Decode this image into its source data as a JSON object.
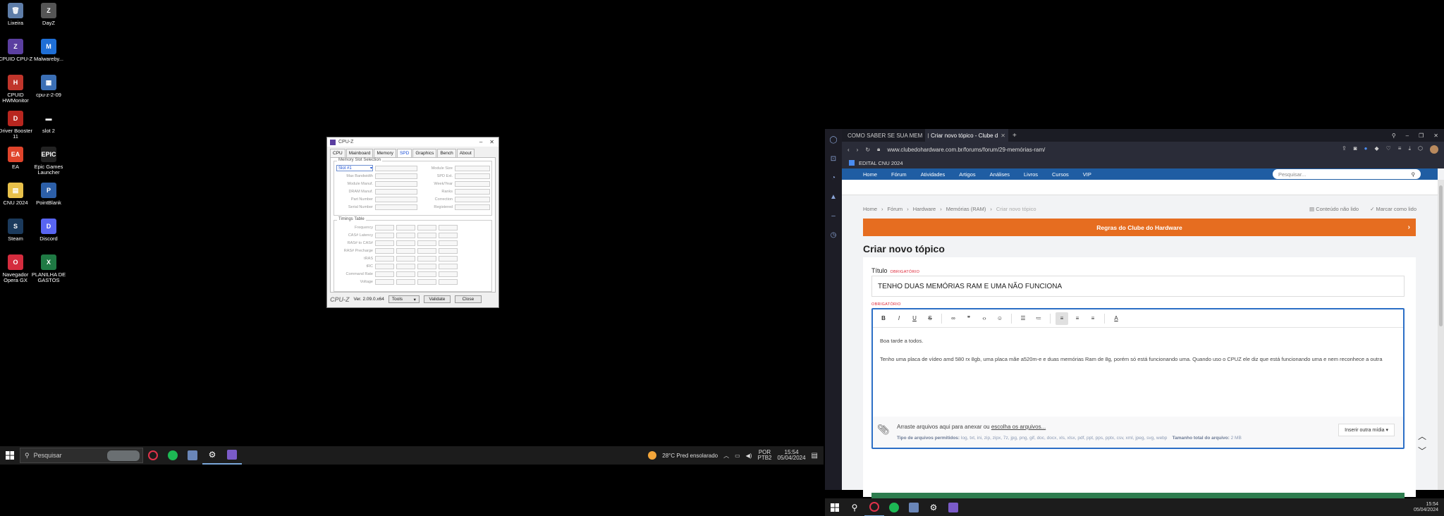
{
  "desktop": {
    "icons": [
      {
        "label": "Lixeira",
        "color": "#5e7da8",
        "glyph": "🗑"
      },
      {
        "label": "DayZ",
        "color": "#555555",
        "glyph": "Z"
      },
      {
        "label": "CPUID CPU-Z",
        "color": "#5b3fa0",
        "glyph": "Z"
      },
      {
        "label": "Malwareby...",
        "color": "#1f6fd6",
        "glyph": "M"
      },
      {
        "label": "CPUID HWMonitor",
        "color": "#c0352b",
        "glyph": "H"
      },
      {
        "label": "cpu-z-2-09",
        "color": "#3b6fb5",
        "glyph": "▦"
      },
      {
        "label": "Driver Booster 11",
        "color": "#b8261f",
        "glyph": "D"
      },
      {
        "label": "slot 2",
        "color": "#000000",
        "glyph": "▬"
      },
      {
        "label": "EA",
        "color": "#e0442b",
        "glyph": "EA"
      },
      {
        "label": "Epic Games Launcher",
        "color": "#222222",
        "glyph": "EPIC"
      },
      {
        "label": "CNU 2024",
        "color": "#e8c14a",
        "glyph": "▤"
      },
      {
        "label": "PointBlank",
        "color": "#2c5fa8",
        "glyph": "P"
      },
      {
        "label": "Steam",
        "color": "#1b3a5c",
        "glyph": "S"
      },
      {
        "label": "Discord",
        "color": "#5865f2",
        "glyph": "D"
      },
      {
        "label": "Navegador Opera GX",
        "color": "#d42c3e",
        "glyph": "O"
      },
      {
        "label": "PLANILHA DE GASTOS",
        "color": "#1f7a44",
        "glyph": "X"
      }
    ]
  },
  "taskbar_left": {
    "search_placeholder": "Pesquisar",
    "weather": "28°C  Pred ensolarado",
    "lang": "POR",
    "lang2": "PTB2",
    "time": "15:54",
    "date": "05/04/2024"
  },
  "cpuz": {
    "title": "CPU-Z",
    "tabs": [
      "CPU",
      "Mainboard",
      "Memory",
      "SPD",
      "Graphics",
      "Bench",
      "About"
    ],
    "selected_tab": "SPD",
    "slot_legend": "Memory Slot Selection",
    "slot_value": "Slot #1",
    "left_fields": [
      "Max Bandwidth",
      "Module Manuf.",
      "DRAM Manuf.",
      "Part Number",
      "Serial Number"
    ],
    "right_fields": [
      "Module Size",
      "SPD Ext.",
      "Week/Year",
      "Ranks",
      "Correction",
      "Registered"
    ],
    "timings_legend": "Timings Table",
    "timing_rows": [
      "Frequency",
      "CAS# Latency",
      "RAS# to CAS#",
      "RAS# Precharge",
      "tRAS",
      "tRC",
      "Command Rate",
      "Voltage"
    ],
    "logo": "CPU-Z",
    "version": "Ver. 2.09.0.x64",
    "tools_label": "Tools",
    "validate_label": "Validate",
    "close_label": "Close"
  },
  "browser": {
    "tabs": [
      {
        "title": "COMO SABER SE SUA MEM",
        "active": false
      },
      {
        "title": "Criar novo tópico - Clube d",
        "active": true
      }
    ],
    "url": "www.clubedohardware.com.br/forums/forum/29-memórias-ram/",
    "bookmark": "EDITAL CNU 2024",
    "nav": [
      "Home",
      "Fórum",
      "Atividades",
      "Artigos",
      "Análises",
      "Livros",
      "Cursos",
      "VIP"
    ],
    "search_placeholder": "Pesquisar...",
    "breadcrumbs": [
      "Home",
      "Fórum",
      "Hardware",
      "Memórias (RAM)",
      "Criar novo tópico"
    ],
    "crumb_actions": [
      "Conteúdo não lido",
      "Marcar como lido"
    ],
    "rules_banner": "Regras do Clube do Hardware",
    "page_title": "Criar novo tópico",
    "title_label": "Título",
    "required": "OBRIGATÓRIO",
    "title_value": "TENHO DUAS MEMÓRIAS RAM E UMA NÃO FUNCIONA",
    "editor_p1": "Boa tarde a todos.",
    "editor_p2": "Tenho uma placa de vídeo amd 580 rx 8gb, uma placa mãe a520m-e e duas memórias Ram de 8g, porém só está funcionando uma. Quando uso o CPUZ ele diz que está funcionando uma e nem reconhece a outra",
    "attach_text": "Arraste arquivos aqui para anexar ou ",
    "attach_link": "escolha os arquivos...",
    "attach_types_label": "Tipo de arquivos permitidos:",
    "attach_types": "log, txt, ini, zip, zipx, 7z, jpg, png, gif, doc, docx, xls, xlsx, pdf, ppt, pps, pptx, csv, xml, jpeg, svg, webp",
    "attach_size_label": "Tamanho total do arquivo:",
    "attach_size": "2 MB",
    "insert_media": "Inserir outra mídia ▾"
  },
  "taskbar_right": {
    "time": "15:54",
    "date": "05/04/2024"
  }
}
